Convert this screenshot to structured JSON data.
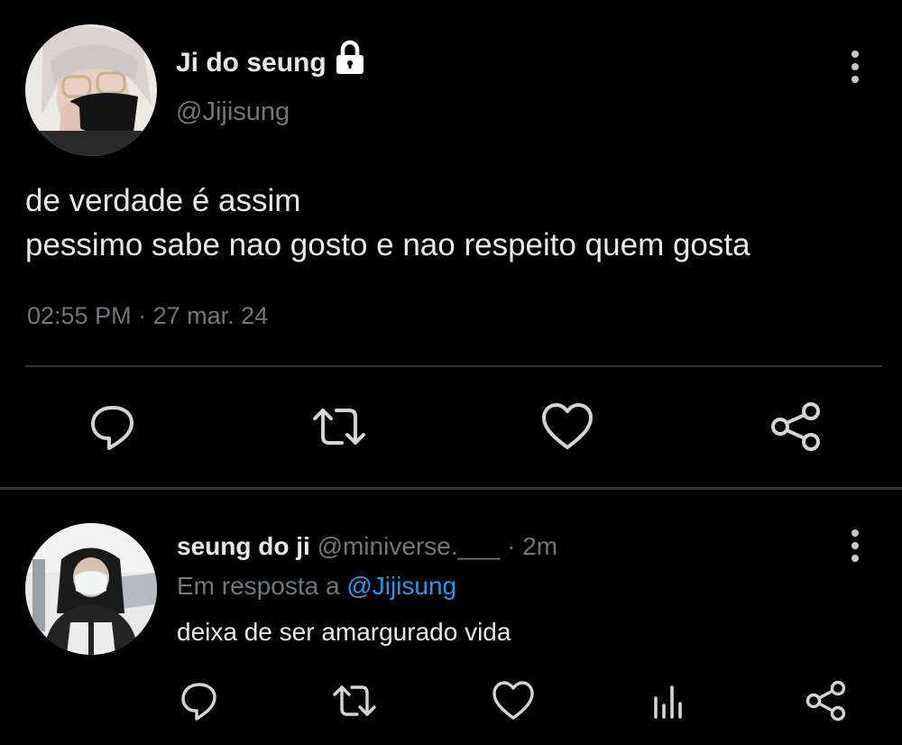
{
  "main_tweet": {
    "display_name": "Ji do seung",
    "handle": "@Jijisung",
    "protected": true,
    "text_lines": [
      "de verdade é assim",
      "pessimo sabe nao gosto e nao respeito quem gosta"
    ],
    "time": "02:55 PM",
    "date": "27 mar. 24",
    "date_separator": "·",
    "actions": [
      "reply-icon",
      "retweet-icon",
      "like-icon",
      "share-icon"
    ]
  },
  "reply": {
    "display_name": "seung do ji",
    "handle": "@miniverse.___",
    "separator": "·",
    "time_ago": "2m",
    "context_prefix": "Em resposta a",
    "context_mention": "@Jijisung",
    "text": "deixa de ser amargurado vida",
    "actions": [
      "reply-icon",
      "retweet-icon",
      "like-icon",
      "analytics-icon",
      "share-icon"
    ]
  },
  "colors": {
    "background": "#000000",
    "text_primary": "#e7e9ea",
    "text_secondary": "#71767b",
    "accent": "#1d9bf0",
    "divider": "#2f3336"
  }
}
